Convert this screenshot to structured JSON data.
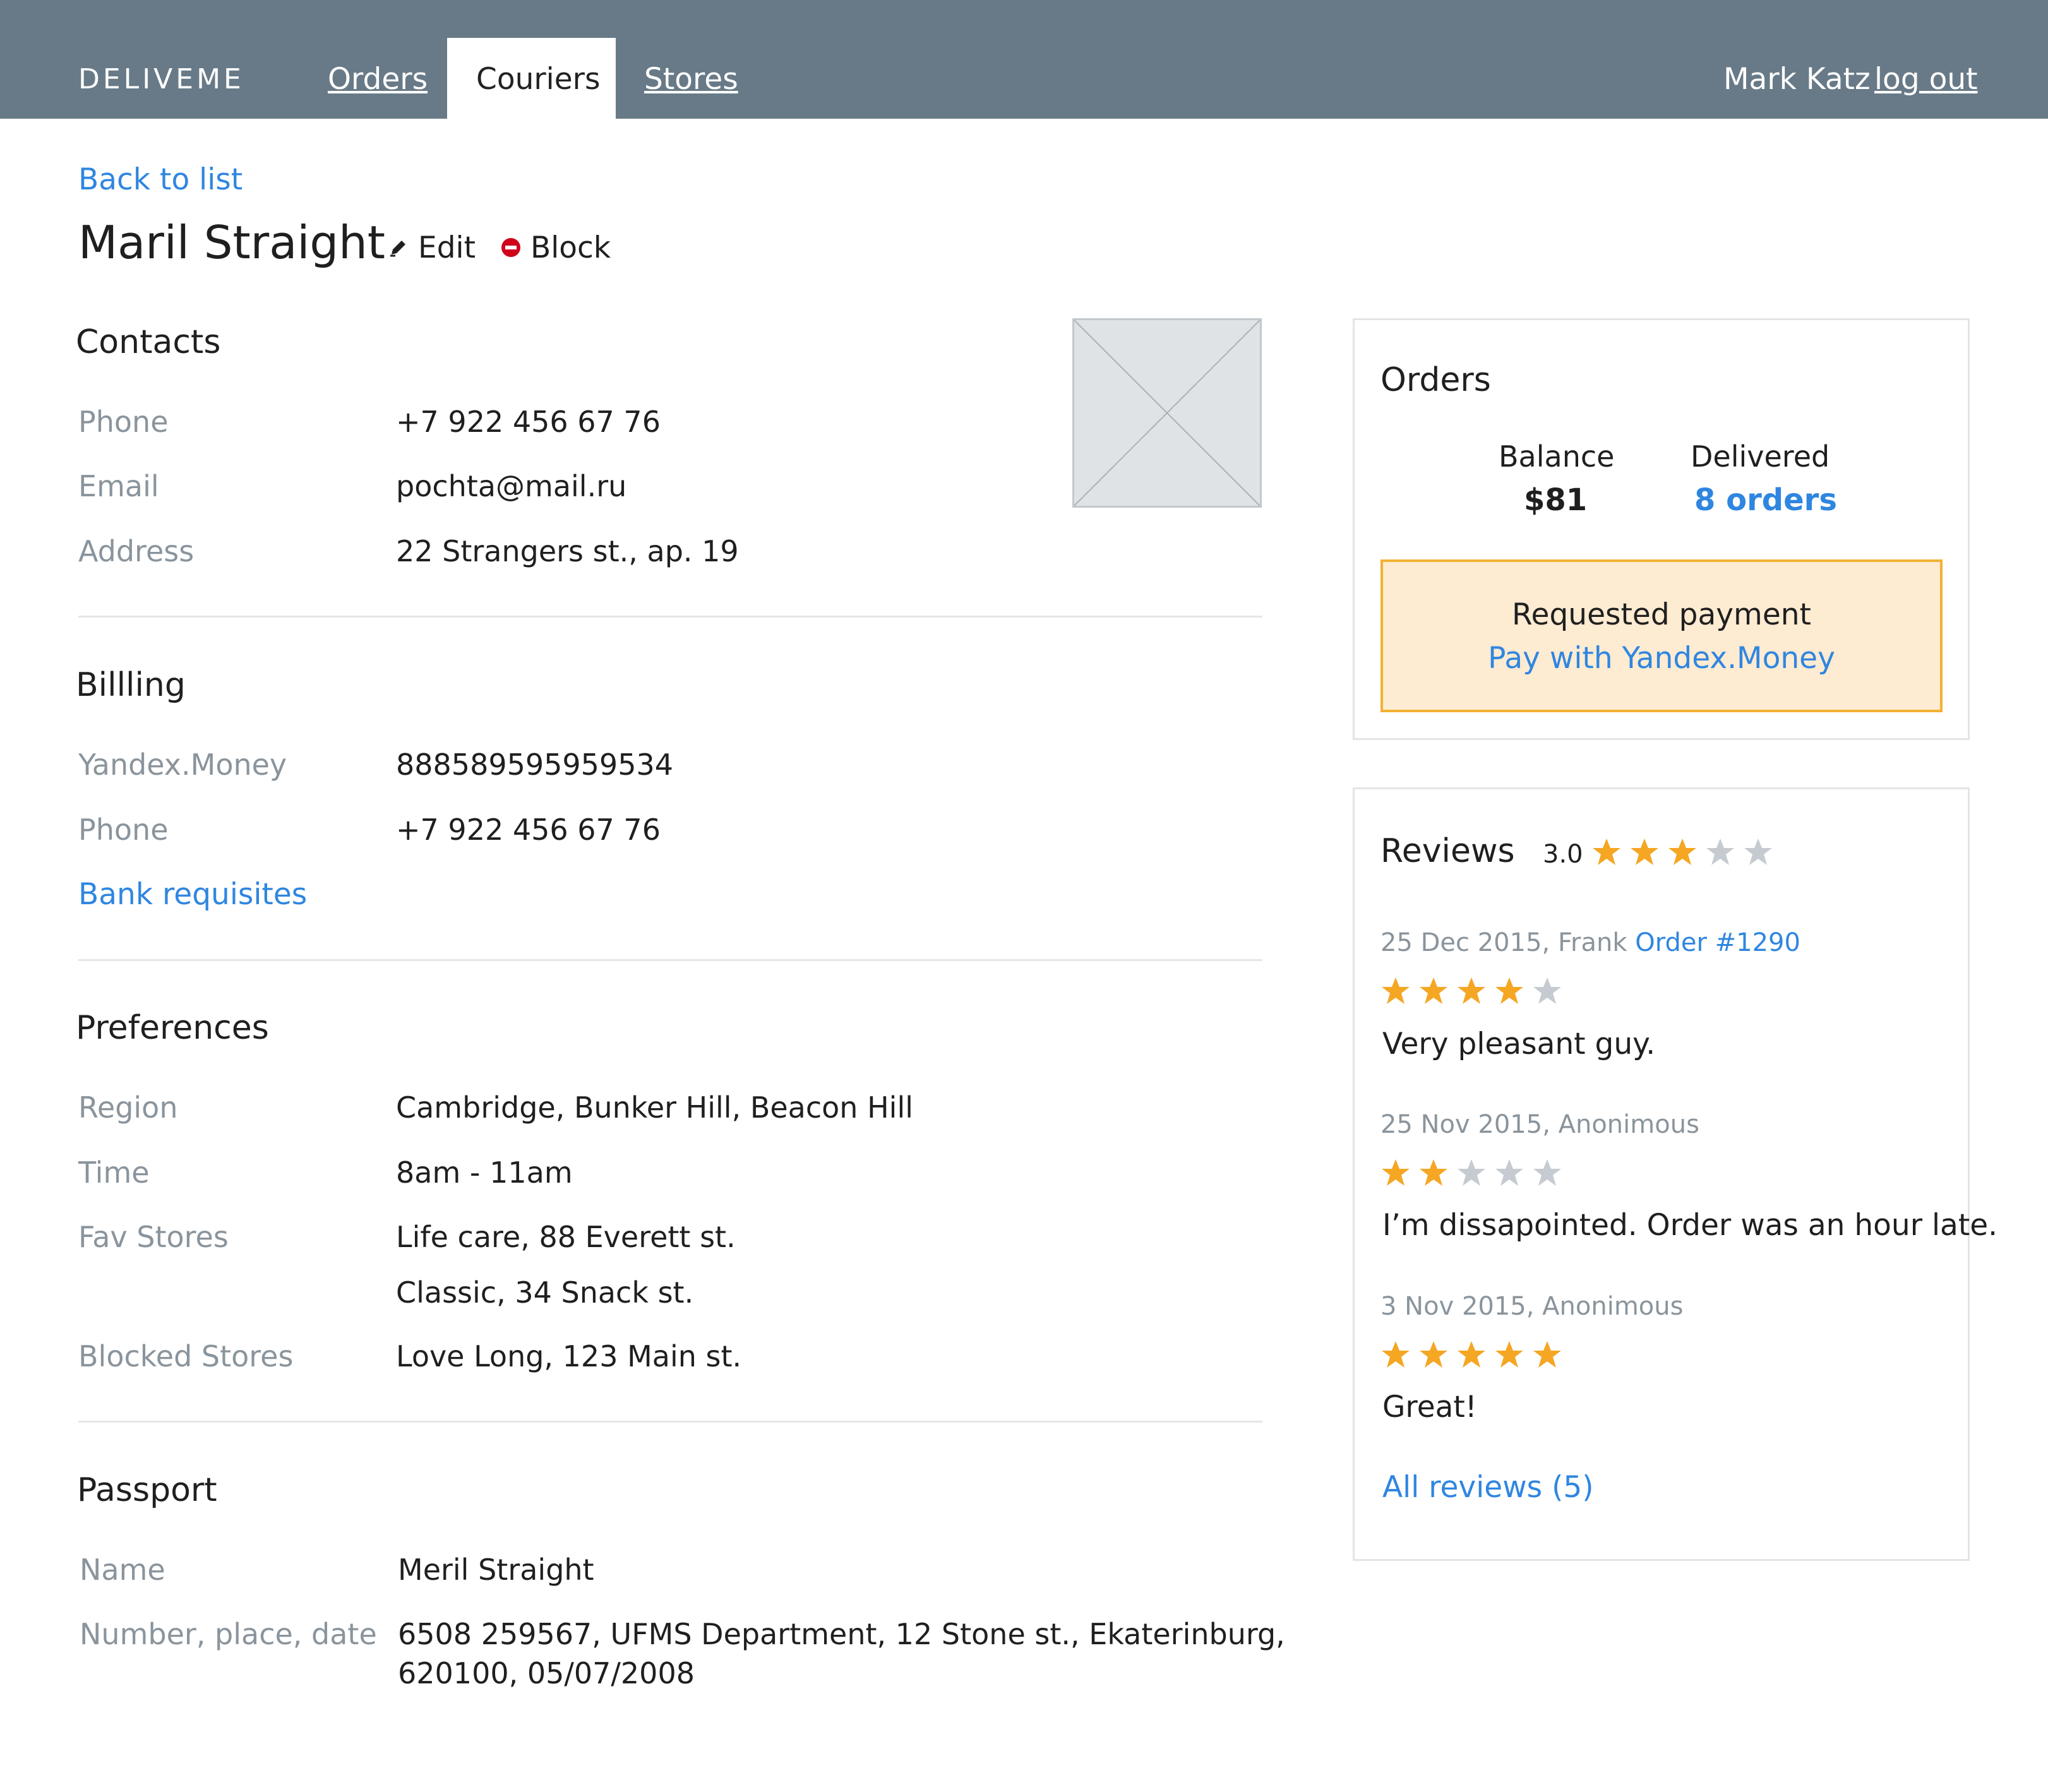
{
  "header": {
    "brand": "DELIVEME",
    "nav": {
      "orders": "Orders",
      "couriers": "Couriers",
      "stores": "Stores"
    },
    "user_name": "Mark Katz",
    "logout": "log out"
  },
  "page": {
    "back_link": "Back to list",
    "title": "Maril Straight",
    "edit_label": "Edit",
    "block_label": "Block"
  },
  "contacts": {
    "title": "Contacts",
    "phone_label": "Phone",
    "phone": "+7 922 456 67 76",
    "email_label": "Email",
    "email": "pochta@mail.ru",
    "address_label": "Address",
    "address": "22 Strangers st., ap. 19"
  },
  "billing": {
    "title": "Billling",
    "yandex_label": "Yandex.Money",
    "yandex": "888589595959534",
    "phone_label": "Phone",
    "phone": "+7 922 456 67 76",
    "bank_link": "Bank requisites"
  },
  "preferences": {
    "title": "Preferences",
    "region_label": "Region",
    "region": "Cambridge, Bunker Hill, Beacon Hill",
    "time_label": "Time",
    "time": "8am - 11am",
    "fav_label": "Fav Stores",
    "fav_stores": [
      "Life care, 88 Everett st.",
      "Classic, 34 Snack st."
    ],
    "blocked_label": "Blocked Stores",
    "blocked_stores": "Love Long, 123 Main st."
  },
  "passport": {
    "title": "Passport",
    "name_label": "Name",
    "name": "Meril Straight",
    "number_label": "Number, place, date",
    "number_line1": "6508 259567, UFMS Department, 12 Stone st., Ekaterinburg,",
    "number_line2": "620100, 05/07/2008"
  },
  "orders_panel": {
    "title": "Orders",
    "balance_label": "Balance",
    "balance_value": "$81",
    "delivered_label": "Delivered",
    "delivered_value": "8 orders",
    "payment_text": "Requested payment",
    "payment_link": "Pay with Yandex.Money"
  },
  "reviews_panel": {
    "title": "Reviews",
    "average": "3.0",
    "average_stars": 3,
    "items": [
      {
        "meta": "25 Dec 2015, Frank",
        "order_link": "Order #1290",
        "stars": 4,
        "text": "Very pleasant guy."
      },
      {
        "meta": "25 Nov 2015, Anonimous",
        "order_link": "",
        "stars": 2,
        "text": "I’m dissapointed. Order was an hour late."
      },
      {
        "meta": "3 Nov 2015, Anonimous",
        "order_link": "",
        "stars": 5,
        "text": "Great!"
      }
    ],
    "all_reviews": "All reviews (5)"
  },
  "colors": {
    "header_bg": "#687a87",
    "link": "#2f86e0",
    "star_filled": "#f5a623",
    "star_empty": "#c5cbd0",
    "payment_bg": "#fdebd2",
    "payment_border": "#f2b132",
    "block_icon": "#d0021b"
  }
}
